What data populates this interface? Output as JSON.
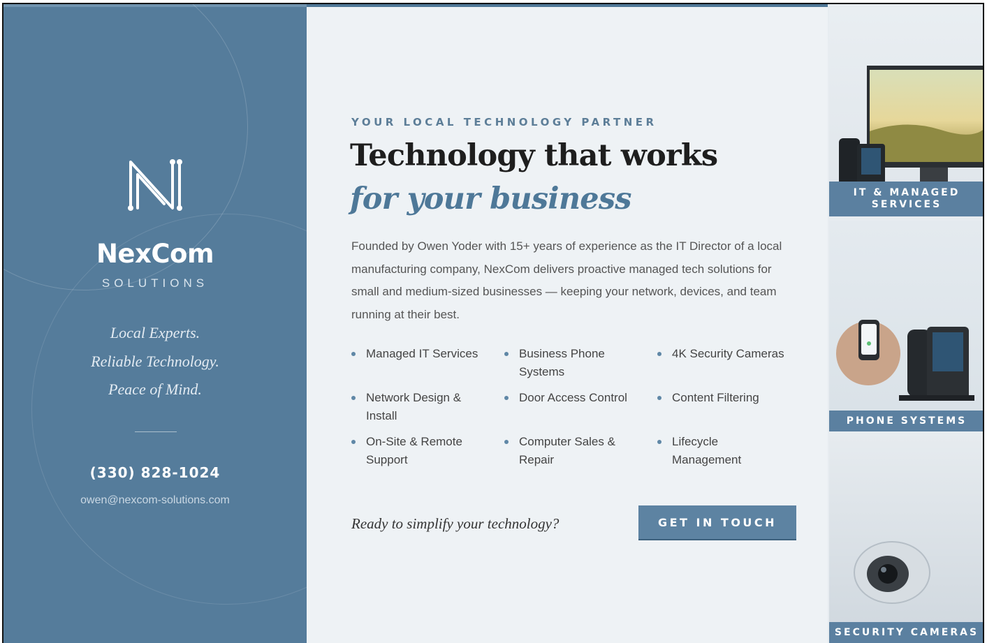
{
  "brand": {
    "name": "NexCom",
    "sub": "SOLUTIONS",
    "taglines": [
      "Local Experts.",
      "Reliable Technology.",
      "Peace of Mind."
    ],
    "phone": "(330) 828-1024",
    "email": "owen@nexcom-solutions.com"
  },
  "hero": {
    "eyebrow": "YOUR LOCAL TECHNOLOGY PARTNER",
    "title_line1": "Technology that works",
    "title_line2": "for your business",
    "intro": "Founded by Owen Yoder with 15+ years of experience as the IT Director of a local manufacturing company, NexCom delivers proactive managed tech solutions for small and medium-sized businesses — keeping your network, devices, and team running at their best."
  },
  "services": [
    "Managed IT Services",
    "Business Phone Systems",
    "4K Security Cameras",
    "Network Design & Install",
    "Door Access Control",
    "Content Filtering",
    "On-Site & Remote Support",
    "Computer Sales & Repair",
    "Lifecycle Management"
  ],
  "cta": {
    "prompt": "Ready to simplify your technology?",
    "button": "GET IN TOUCH"
  },
  "tiles": {
    "it": "IT & MANAGED SERVICES",
    "phone": "PHONE SYSTEMS",
    "security": "SECURITY CAMERAS"
  },
  "colors": {
    "brand_blue": "#557c9b",
    "accent_blue": "#4e7898",
    "button_blue": "#5d83a2",
    "background": "#eef2f5"
  }
}
